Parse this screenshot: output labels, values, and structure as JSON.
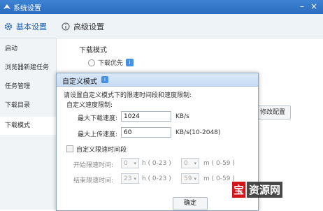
{
  "window": {
    "title": "系统设置",
    "accent": "#2c6cc0"
  },
  "tabs": [
    {
      "label": "基本设置",
      "icon": "gear-icon"
    },
    {
      "label": "高级设置",
      "icon": "info-circle-icon"
    }
  ],
  "sidebar": {
    "items": [
      {
        "label": "启动"
      },
      {
        "label": "浏览器新建任务"
      },
      {
        "label": "任务管理"
      },
      {
        "label": "下载目录"
      },
      {
        "label": "下载模式"
      }
    ],
    "selected": "下载模式"
  },
  "content": {
    "section_title": "下载模式",
    "option_label": "下载优先",
    "modify_button": "修改配置"
  },
  "dialog": {
    "title": "自定义模式",
    "description": "请设置自定义模式下的限速时间段和速度限制:",
    "speed_section": "自定义速度限制:",
    "max_download_label": "最大下载速度:",
    "max_download_value": "1024",
    "max_download_unit": "KB/s",
    "max_upload_label": "最大上传速度:",
    "max_upload_value": "60",
    "max_upload_unit": "KB/s(10-2048)",
    "custom_time_label": "自定义限速时间段",
    "start_label": "开始限速时间:",
    "start_hour": "0",
    "start_min": "0",
    "end_label": "结束限速时间:",
    "end_hour": "23",
    "end_min": "59",
    "hour_unit": "h ( 0-23 )",
    "min_unit": "m ( 0-59 )",
    "ok_button": "确定"
  },
  "watermark": {
    "red": "宝",
    "text": "资源网"
  }
}
